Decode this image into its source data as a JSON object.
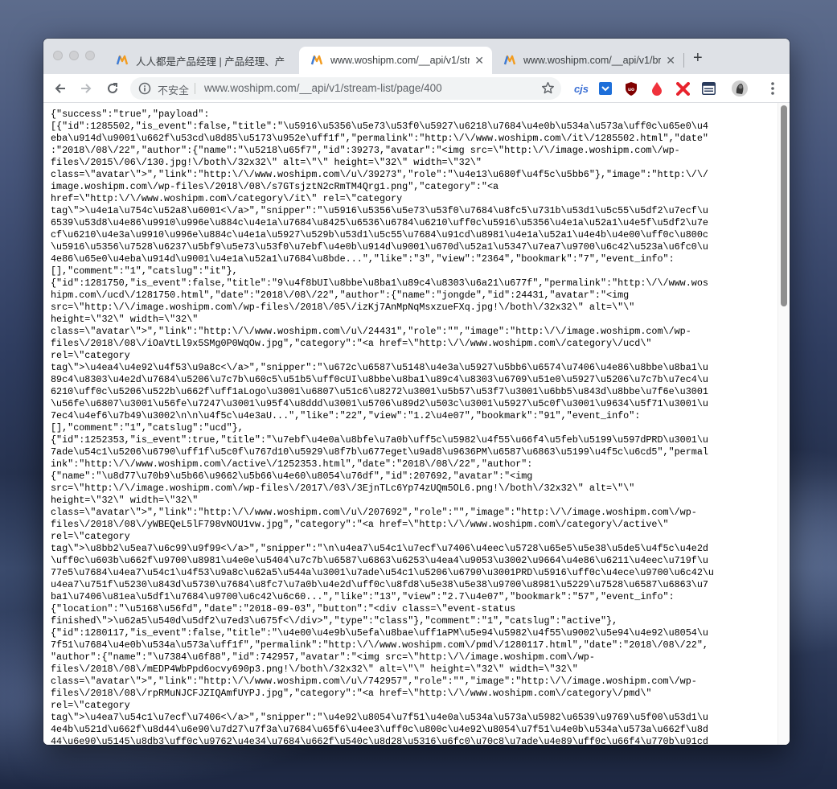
{
  "browser": {
    "tabs": [
      {
        "title": "人人都是产品经理 | 产品经理、产",
        "active": false
      },
      {
        "title": "www.woshipm.com/__api/v1/str",
        "active": true
      },
      {
        "title": "www.woshipm.com/__api/v1/br",
        "active": false
      }
    ],
    "new_tab": "+",
    "address": {
      "security_label": "不安全",
      "url": "www.woshipm.com/__api/v1/stream-list/page/400"
    },
    "extensions": [
      "cjs"
    ]
  },
  "content": {
    "lines": [
      "{\"success\":\"true\",\"payload\":",
      "[{\"id\":1285502,\"is_event\":false,\"title\":\"\\u5916\\u5356\\u5e73\\u53f0\\u5927\\u6218\\u7684\\u4e0b\\u534a\\u573a\\uff0c\\u65e0\\u4",
      "eba\\u914d\\u9001\\u662f\\u53cd\\u8d85\\u5173\\u952e\\uff1f\",\"permalink\":\"http:\\/\\/www.woshipm.com\\/it\\/1285502.html\",\"date\"",
      ":\"2018\\/08\\/22\",\"author\":{\"name\":\"\\u5218\\u65f7\",\"id\":39273,\"avatar\":\"<img src=\\\"http:\\/\\/image.woshipm.com\\/wp-",
      "files\\/2015\\/06\\/130.jpg!\\/both\\/32x32\\\" alt=\\\"\\\" height=\\\"32\\\" width=\\\"32\\\"",
      "class=\\\"avatar\\\">\",\"link\":\"http:\\/\\/www.woshipm.com\\/u\\/39273\",\"role\":\"\\u4e13\\u680f\\u4f5c\\u5bb6\"},\"image\":\"http:\\/\\/",
      "image.woshipm.com\\/wp-files\\/2018\\/08\\/s7GTsjztN2cRmTM4Qrg1.png\",\"category\":\"<a",
      "href=\\\"http:\\/\\/www.woshipm.com\\/category\\/it\\\" rel=\\\"category",
      "tag\\\">\\u4e1a\\u754c\\u52a8\\u6001<\\/a>\",\"snipper\":\"\\u5916\\u5356\\u5e73\\u53f0\\u7684\\u8fc5\\u731b\\u53d1\\u5c55\\u5df2\\u7ecf\\u",
      "6539\\u53d8\\u4e86\\u9910\\u996e\\u884c\\u4e1a\\u7684\\u8425\\u6536\\u6784\\u6210\\uff0c\\u5916\\u5356\\u4e1a\\u52a1\\u4e5f\\u5df2\\u7e",
      "cf\\u6210\\u4e3a\\u9910\\u996e\\u884c\\u4e1a\\u5927\\u529b\\u53d1\\u5c55\\u7684\\u91cd\\u8981\\u4e1a\\u52a1\\u4e4b\\u4e00\\uff0c\\u800c",
      "\\u5916\\u5356\\u7528\\u6237\\u5bf9\\u5e73\\u53f0\\u7ebf\\u4e0b\\u914d\\u9001\\u670d\\u52a1\\u5347\\u7ea7\\u9700\\u6c42\\u523a\\u6fc0\\u",
      "4e86\\u65e0\\u4eba\\u914d\\u9001\\u4e1a\\u52a1\\u7684\\u8bde...\",\"like\":\"3\",\"view\":\"2364\",\"bookmark\":\"7\",\"event_info\":",
      "[],\"comment\":\"1\",\"catslug\":\"it\"},",
      "{\"id\":1281750,\"is_event\":false,\"title\":\"9\\u4f8bUI\\u8bbe\\u8ba1\\u89c4\\u8303\\u6a21\\u677f\",\"permalink\":\"http:\\/\\/www.wos",
      "hipm.com\\/ucd\\/1281750.html\",\"date\":\"2018\\/08\\/22\",\"author\":{\"name\":\"jongde\",\"id\":24431,\"avatar\":\"<img",
      "src=\\\"http:\\/\\/image.woshipm.com\\/wp-files\\/2018\\/05\\/izKj7AnMpNqMsxzueFXq.jpg!\\/both\\/32x32\\\" alt=\\\"\\\"",
      "height=\\\"32\\\" width=\\\"32\\\"",
      "class=\\\"avatar\\\">\",\"link\":\"http:\\/\\/www.woshipm.com\\/u\\/24431\",\"role\":\"\",\"image\":\"http:\\/\\/image.woshipm.com\\/wp-",
      "files\\/2018\\/08\\/iOaVtLl9x5SMg0P0WqOw.jpg\",\"category\":\"<a href=\\\"http:\\/\\/www.woshipm.com\\/category\\/ucd\\\"",
      "rel=\\\"category",
      "tag\\\">\\u4ea4\\u4e92\\u4f53\\u9a8c<\\/a>\",\"snipper\":\"\\u672c\\u6587\\u5148\\u4e3a\\u5927\\u5bb6\\u6574\\u7406\\u4e86\\u8bbe\\u8ba1\\u",
      "89c4\\u8303\\u4e2d\\u7684\\u5206\\u7c7b\\u60c5\\u51b5\\uff0cUI\\u8bbe\\u8ba1\\u89c4\\u8303\\u6709\\u51e0\\u5927\\u5206\\u7c7b\\u7ec4\\u",
      "6210\\uff0c\\u5206\\u522b\\u662f\\uff1aLogo\\u3001\\u6807\\u51c6\\u8272\\u3001\\u5b57\\u53f7\\u3001\\u6bb5\\u843d\\u8bbe\\u7f6e\\u3001",
      "\\u56fe\\u6807\\u3001\\u56fe\\u7247\\u3001\\u95f4\\u8ddd\\u3001\\u5706\\u89d2\\u503c\\u3001\\u5927\\u5c0f\\u3001\\u9634\\u5f71\\u3001\\u",
      "7ec4\\u4ef6\\u7b49\\u3002\\n\\n\\u4f5c\\u4e3aU...\",\"like\":\"22\",\"view\":\"1.2\\u4e07\",\"bookmark\":\"91\",\"event_info\":",
      "[],\"comment\":\"1\",\"catslug\":\"ucd\"},",
      "{\"id\":1252353,\"is_event\":true,\"title\":\"\\u7ebf\\u4e0a\\u8bfe\\u7a0b\\uff5c\\u5982\\u4f55\\u66f4\\u5feb\\u5199\\u597dPRD\\u3001\\u",
      "7ade\\u54c1\\u5206\\u6790\\uff1f\\u5c0f\\u767d10\\u5929\\u8f7b\\u677eget\\u9ad8\\u9636PM\\u6587\\u6863\\u5199\\u4f5c\\u6cd5\",\"permal",
      "ink\":\"http:\\/\\/www.woshipm.com\\/active\\/1252353.html\",\"date\":\"2018\\/08\\/22\",\"author\":",
      "{\"name\":\"\\u8d77\\u70b9\\u5b66\\u9662\\u5b66\\u4e60\\u8054\\u76df\",\"id\":207692,\"avatar\":\"<img",
      "src=\\\"http:\\/\\/image.woshipm.com\\/wp-files\\/2017\\/03\\/3EjnTLc6Yp74zUQm5OL6.png!\\/both\\/32x32\\\" alt=\\\"\\\"",
      "height=\\\"32\\\" width=\\\"32\\\"",
      "class=\\\"avatar\\\">\",\"link\":\"http:\\/\\/www.woshipm.com\\/u\\/207692\",\"role\":\"\",\"image\":\"http:\\/\\/image.woshipm.com\\/wp-",
      "files\\/2018\\/08\\/yWBEQeL5lF798vNOU1vw.jpg\",\"category\":\"<a href=\\\"http:\\/\\/www.woshipm.com\\/category\\/active\\\"",
      "rel=\\\"category",
      "tag\\\">\\u8bb2\\u5ea7\\u6c99\\u9f99<\\/a>\",\"snipper\":\"\\n\\u4ea7\\u54c1\\u7ecf\\u7406\\u4eec\\u5728\\u65e5\\u5e38\\u5de5\\u4f5c\\u4e2d",
      "\\uff0c\\u603b\\u662f\\u9700\\u8981\\u4e0e\\u5404\\u7c7b\\u6587\\u6863\\u6253\\u4ea4\\u9053\\u3002\\u9664\\u4e86\\u6211\\u4eec\\u719f\\u",
      "77e5\\u7684\\u4ea7\\u54c1\\u4f53\\u9a8c\\u62a5\\u544a\\u3001\\u7ade\\u54c1\\u5206\\u6790\\u3001PRD\\u5916\\uff0c\\u4ece\\u9700\\u6c42\\u",
      "u4ea7\\u751f\\u5230\\u843d\\u5730\\u7684\\u8fc7\\u7a0b\\u4e2d\\uff0c\\u8fd8\\u5e38\\u5e38\\u9700\\u8981\\u5229\\u7528\\u6587\\u6863\\u7",
      "ba1\\u7406\\u81ea\\u5df1\\u7684\\u9700\\u6c42\\u6c60...\",\"like\":\"13\",\"view\":\"2.7\\u4e07\",\"bookmark\":\"57\",\"event_info\":",
      "{\"location\":\"\\u5168\\u56fd\",\"date\":\"2018-09-03\",\"button\":\"<div class=\\\"event-status",
      "finished\\\">\\u62a5\\u540d\\u5df2\\u7ed3\\u675f<\\/div>\",\"type\":\"class\"},\"comment\":\"1\",\"catslug\":\"active\"},",
      "{\"id\":1280117,\"is_event\":false,\"title\":\"\\u4e00\\u4e9b\\u5efa\\u8bae\\uff1aPM\\u5e94\\u5982\\u4f55\\u9002\\u5e94\\u4e92\\u8054\\u",
      "7f51\\u7684\\u4e0b\\u534a\\u573a\\uff1f\",\"permalink\":\"http:\\/\\/www.woshipm.com\\/pmd\\/1280117.html\",\"date\":\"2018\\/08\\/22\",",
      "\"author\":{\"name\":\"\\u7384\\u6f88\",\"id\":742957,\"avatar\":\"<img src=\\\"http:\\/\\/image.woshipm.com\\/wp-",
      "files\\/2018\\/08\\/mEDP4WbPpd6ocvy690p3.png!\\/both\\/32x32\\\" alt=\\\"\\\" height=\\\"32\\\" width=\\\"32\\\"",
      "class=\\\"avatar\\\">\",\"link\":\"http:\\/\\/www.woshipm.com\\/u\\/742957\",\"role\":\"\",\"image\":\"http:\\/\\/image.woshipm.com\\/wp-",
      "files\\/2018\\/08\\/rpRMuNJCFJZIQAmfUYPJ.jpg\",\"category\":\"<a href=\\\"http:\\/\\/www.woshipm.com\\/category\\/pmd\\\"",
      "rel=\\\"category",
      "tag\\\">\\u4ea7\\u54c1\\u7ecf\\u7406<\\/a>\",\"snipper\":\"\\u4e92\\u8054\\u7f51\\u4e0a\\u534a\\u573a\\u5982\\u6539\\u9769\\u5f00\\u53d1\\u",
      "4e4b\\u521d\\u662f\\u8d44\\u6e90\\u7d27\\u7f3a\\u7684\\u65f6\\u4ee3\\uff0c\\u800c\\u4e92\\u8054\\u7f51\\u4e0b\\u534a\\u573a\\u662f\\u8d",
      "44\\u6e90\\u5145\\u8db3\\uff0c\\u9762\\u4e34\\u7684\\u662f\\u540c\\u8d28\\u5316\\u6fc0\\u70c8\\u7ade\\u4e89\\uff0c\\u66f4\\u770b\\u91cd"
    ]
  }
}
